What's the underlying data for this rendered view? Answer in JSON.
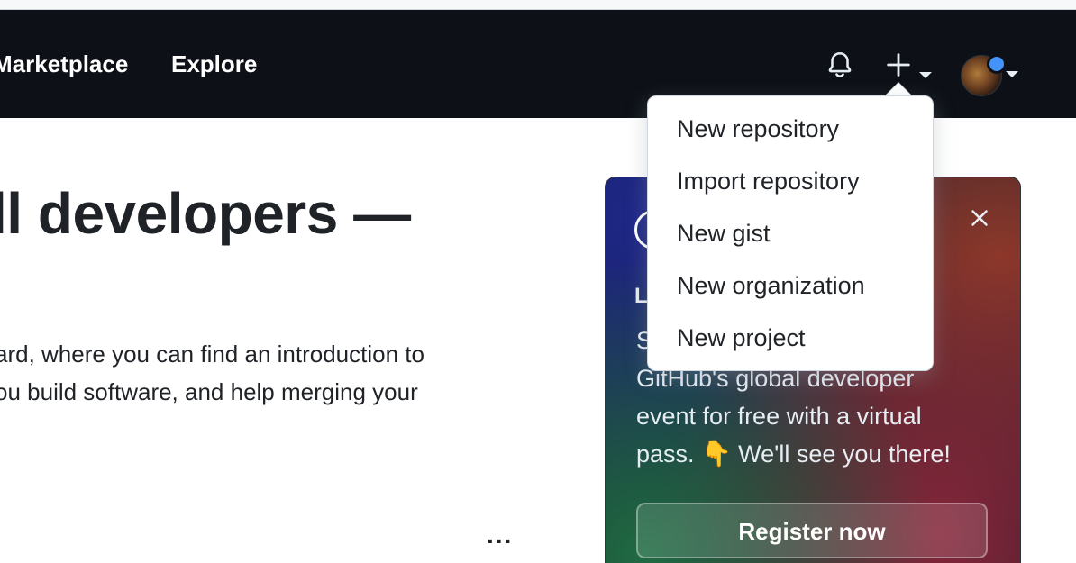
{
  "header": {
    "nav": [
      {
        "label": "Marketplace"
      },
      {
        "label": "Explore"
      }
    ],
    "icons": {
      "notifications": "bell-icon",
      "create": "plus-icon",
      "avatar": "user-avatar"
    }
  },
  "main": {
    "hero_title": "ll developers —",
    "hero_lines": [
      "ard, where you can find an introduction to",
      "ou build software, and help merging your"
    ],
    "more": "..."
  },
  "promo": {
    "kicker": "L",
    "lines": [
      "S                                              e",
      "GitHub's global developer",
      "event for free with a virtual",
      "pass. 👇 We'll see you there!"
    ],
    "button_label": "Register now",
    "close_icon": "close-icon"
  },
  "dropdown": {
    "items": [
      {
        "label": "New repository"
      },
      {
        "label": "Import repository"
      },
      {
        "label": "New gist"
      },
      {
        "label": "New organization"
      },
      {
        "label": "New project"
      }
    ]
  },
  "colors": {
    "header_bg": "#0d1117",
    "text": "#1f2328",
    "accent_dot": "#4493f8"
  }
}
